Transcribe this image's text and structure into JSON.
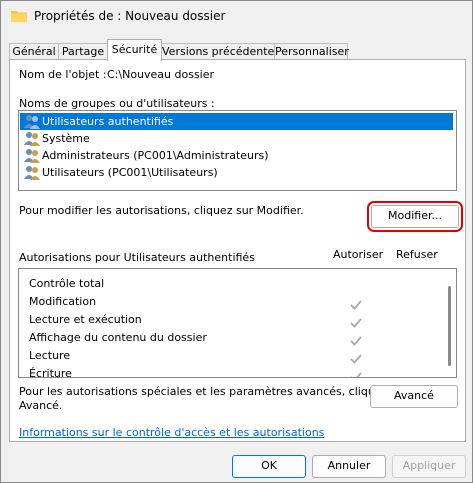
{
  "window": {
    "title": "Propriétés de : Nouveau dossier",
    "icon": "folder-icon"
  },
  "tabs": [
    {
      "label": "Général"
    },
    {
      "label": "Partage"
    },
    {
      "label": "Sécurité"
    },
    {
      "label": "Versions précédentes"
    },
    {
      "label": "Personnaliser"
    }
  ],
  "security": {
    "object_label": "Nom de l'objet :",
    "object_value": "C:\\Nouveau dossier",
    "groups_label": "Noms de groupes ou d'utilisateurs :",
    "groups": [
      {
        "label": "Utilisateurs authentifiés",
        "icon": "users-icon"
      },
      {
        "label": "Système",
        "icon": "users-icon"
      },
      {
        "label": "Administrateurs (PC001\\Administrateurs)",
        "icon": "users-icon"
      },
      {
        "label": "Utilisateurs (PC001\\Utilisateurs)",
        "icon": "users-icon"
      }
    ],
    "modify_hint": "Pour modifier les autorisations, cliquez sur Modifier.",
    "modify_button": "Modifier...",
    "permissions_label": "Autorisations pour Utilisateurs authentifiés",
    "allow_header": "Autoriser",
    "deny_header": "Refuser",
    "permissions": [
      {
        "label": "Contrôle total",
        "allow": false,
        "deny": false
      },
      {
        "label": "Modification",
        "allow": true,
        "deny": false
      },
      {
        "label": "Lecture et exécution",
        "allow": true,
        "deny": false
      },
      {
        "label": "Affichage du contenu du dossier",
        "allow": true,
        "deny": false
      },
      {
        "label": "Lecture",
        "allow": true,
        "deny": false
      },
      {
        "label": "Écriture",
        "allow": true,
        "deny": false
      }
    ],
    "advanced_hint_line1": "Pour les autorisations spéciales et les paramètres avancés, cliquez sur",
    "advanced_hint_line2": "Avancé.",
    "advanced_button": "Avancé",
    "info_link": "Informations sur le contrôle d'accès et les autorisations"
  },
  "footer": {
    "ok": "OK",
    "cancel": "Annuler",
    "apply": "Appliquer"
  },
  "colors": {
    "selection": "#0078d7",
    "highlight_outline": "#e00000",
    "link": "#0066cc"
  }
}
